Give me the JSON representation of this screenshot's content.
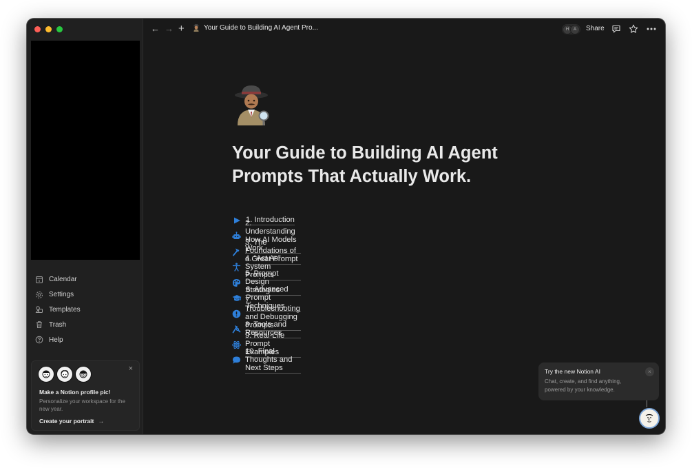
{
  "window": {
    "breadcrumb_title": "Your Guide to Building AI Agent Pro...",
    "share_label": "Share",
    "presence": [
      "H",
      "A"
    ]
  },
  "sidebar": {
    "items": [
      {
        "label": "Calendar",
        "icon": "calendar-icon"
      },
      {
        "label": "Settings",
        "icon": "gear-icon"
      },
      {
        "label": "Templates",
        "icon": "templates-icon"
      },
      {
        "label": "Trash",
        "icon": "trash-icon"
      },
      {
        "label": "Help",
        "icon": "help-icon"
      }
    ],
    "calendar_day": "6",
    "promo": {
      "title": "Make a Notion profile pic!",
      "description": "Personalize your workspace for the new year.",
      "cta": "Create your portrait",
      "cta_arrow": "→",
      "close": "×"
    }
  },
  "page": {
    "icon": "detective-emoji",
    "title": "Your Guide to Building AI Agent Prompts That Actually Work.",
    "toc": [
      {
        "label": "1. Introduction",
        "icon": "play-icon"
      },
      {
        "label": "2. Understanding How AI Models Work",
        "icon": "robot-icon"
      },
      {
        "label": "3. The Foundations of a Great Prompt",
        "icon": "hammer-icon"
      },
      {
        "label": "4. “Act As” System Prompts",
        "icon": "person-icon"
      },
      {
        "label": "5. Prompt Design Strategies",
        "icon": "palette-icon"
      },
      {
        "label": "6. Advanced Prompt Techniques",
        "icon": "graduation-cap-icon"
      },
      {
        "label": "7. Troubleshooting and Debugging Prompts",
        "icon": "alert-icon"
      },
      {
        "label": "8. Tools and Resources",
        "icon": "tools-icon"
      },
      {
        "label": "9. Real-Life Prompt Examples",
        "icon": "atom-icon"
      },
      {
        "label": "10. Final Thoughts and Next Steps",
        "icon": "speech-bubble-icon"
      }
    ]
  },
  "ai": {
    "title": "Try the new Notion AI",
    "description": "Chat, create, and find anything, powered by your knowledge.",
    "close": "×"
  },
  "colors": {
    "accent_blue": "#2e7fd9",
    "background": "#191919",
    "sidebar": "#202020"
  }
}
